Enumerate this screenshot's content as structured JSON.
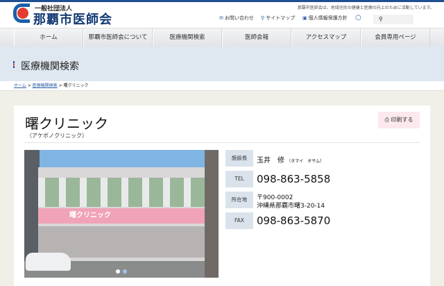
{
  "header": {
    "logo_sub": "一般社団法人",
    "logo_main": "那覇市医師会",
    "tagline": "那覇市医師会は、地域住民の健康と医療の向上のために活動しています。",
    "util_links": [
      {
        "icon": "mail-icon",
        "label": "お問い合わせ"
      },
      {
        "icon": "sitemap-icon",
        "label": "サイトマップ"
      },
      {
        "icon": "privacy-icon",
        "label": "個人情報保護方針"
      }
    ],
    "search_placeholder": ""
  },
  "nav": [
    "ホーム",
    "那覇市医師会について",
    "医療機関検索",
    "医師会報",
    "アクセスマップ",
    "会員専用ページ"
  ],
  "page_title": "医療機関検索",
  "breadcrumb": [
    "ホーム",
    "医療機関検索",
    "曙クリニック"
  ],
  "clinic": {
    "name": "曙クリニック",
    "reading": "（アケボノクリニック）",
    "print_label": "印刷する",
    "photo_sign": "曙クリニック",
    "info": [
      {
        "label": "施設長",
        "value": "玉井　修",
        "reading": "（タマイ　オサム）"
      },
      {
        "label": "TEL",
        "value": "098-863-5858"
      },
      {
        "label": "所在地",
        "postal": "〒900-0002",
        "address": "沖縄県那覇市曙3-20-14"
      },
      {
        "label": "FAX",
        "value": "098-863-5870"
      }
    ]
  }
}
